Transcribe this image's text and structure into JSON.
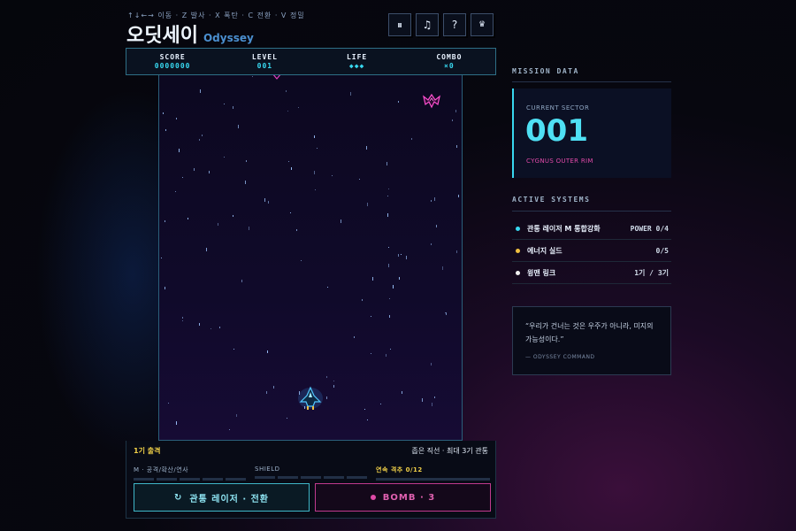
{
  "header": {
    "controls_hint": "↑↓←→ 이동 · Z 발사 · X 폭탄 · C 전환 · V 정밀",
    "title": "오딧세이",
    "subtitle": "Odyssey",
    "buttons": [
      {
        "icon": "pause-icon",
        "glyph": "⏸"
      },
      {
        "icon": "music-icon",
        "glyph": "♫"
      },
      {
        "icon": "help-icon",
        "glyph": "?"
      },
      {
        "icon": "crown-icon",
        "glyph": "♛"
      }
    ]
  },
  "hud": {
    "score_label": "SCORE",
    "score_value": "0000000",
    "level_label": "LEVEL",
    "level_value": "001",
    "life_label": "LIFE",
    "life_value": "◆◆◆",
    "combo_label": "COMBO",
    "combo_value": "×0"
  },
  "bottom": {
    "launch_status": "1기 출격",
    "weapon_info": "좁은 직선 · 최대 3기 관통",
    "meters": [
      {
        "label": "M · 공격/확산/연사",
        "segments": 5,
        "filled": 0
      },
      {
        "label": "SHIELD",
        "segments": 5,
        "filled": 0
      },
      {
        "label": "연속 격추 0/12",
        "segments": 1,
        "filled": 0
      }
    ],
    "laser_button": "관통 레이저 · 전환",
    "laser_icon": "↻",
    "bomb_button": "BOMB · 3"
  },
  "right_panel": {
    "mission_heading": "MISSION DATA",
    "sector_label": "CURRENT SECTOR",
    "sector_number": "001",
    "sector_name": "CYGNUS OUTER RIM",
    "systems_heading": "ACTIVE SYSTEMS",
    "systems": [
      {
        "name": "관통 레이저 M 통합강화",
        "value": "POWER 0/4",
        "color": "#38d8f0"
      },
      {
        "name": "에너지 실드",
        "value": "0/5",
        "color": "#f0c040"
      },
      {
        "name": "윙맨 링크",
        "value": "1기 / 3기",
        "color": "#f0f0f0"
      }
    ],
    "quote": "“우리가 건너는 것은 우주가 아니라, 미지의 가능성이다.”",
    "quote_source": "— ODYSSEY COMMAND"
  },
  "colors": {
    "accent_cyan": "#38d8f0",
    "accent_pink": "#e04aa8",
    "accent_gold": "#f0d048",
    "background": "#07070f"
  }
}
